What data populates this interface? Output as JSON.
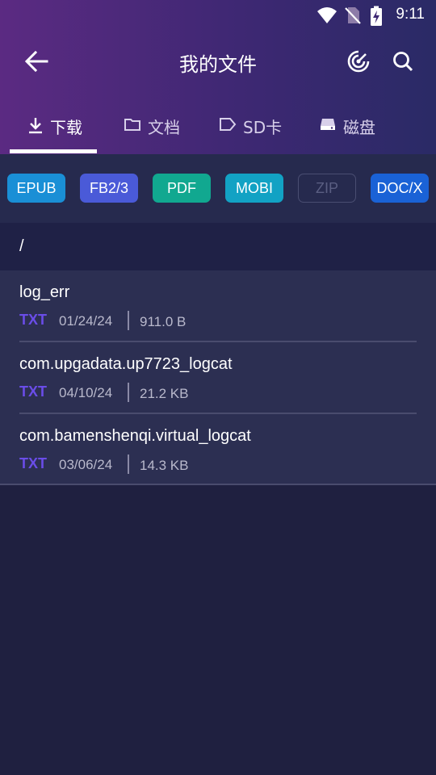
{
  "status": {
    "time": "9:11",
    "icons": [
      "wifi-icon",
      "no-sim-icon",
      "battery-charging-icon"
    ]
  },
  "toolbar": {
    "title": "我的文件",
    "back_icon": "arrow-left-icon",
    "actions": [
      "radar-icon",
      "search-icon"
    ]
  },
  "tabs": [
    {
      "label": "下载",
      "icon": "download-icon",
      "active": true
    },
    {
      "label": "文档",
      "icon": "folder-icon",
      "active": false
    },
    {
      "label": "SD卡",
      "icon": "sd-card-icon",
      "active": false
    },
    {
      "label": "磁盘",
      "icon": "disk-icon",
      "active": false
    }
  ],
  "filters": [
    {
      "label": "EPUB",
      "color": "#1a8fd6"
    },
    {
      "label": "FB2/3",
      "color": "#4a5ad8"
    },
    {
      "label": "PDF",
      "color": "#11a890"
    },
    {
      "label": "MOBI",
      "color": "#12a2c4"
    },
    {
      "label": "ZIP",
      "color": "#4a4e72",
      "outlined": true
    },
    {
      "label": "DOC/X",
      "color": "#1a62d6"
    }
  ],
  "path": "/",
  "files": [
    {
      "name": "log_err",
      "type": "TXT",
      "date": "01/24/24",
      "size": "911.0 B"
    },
    {
      "name": "com.upgadata.up7723_logcat",
      "type": "TXT",
      "date": "04/10/24",
      "size": "21.2 KB"
    },
    {
      "name": "com.bamenshenqi.virtual_logcat",
      "type": "TXT",
      "date": "03/06/24",
      "size": "14.3 KB"
    }
  ],
  "colors": {
    "accent_type": "#6a4de8",
    "background": "#1f2040"
  }
}
